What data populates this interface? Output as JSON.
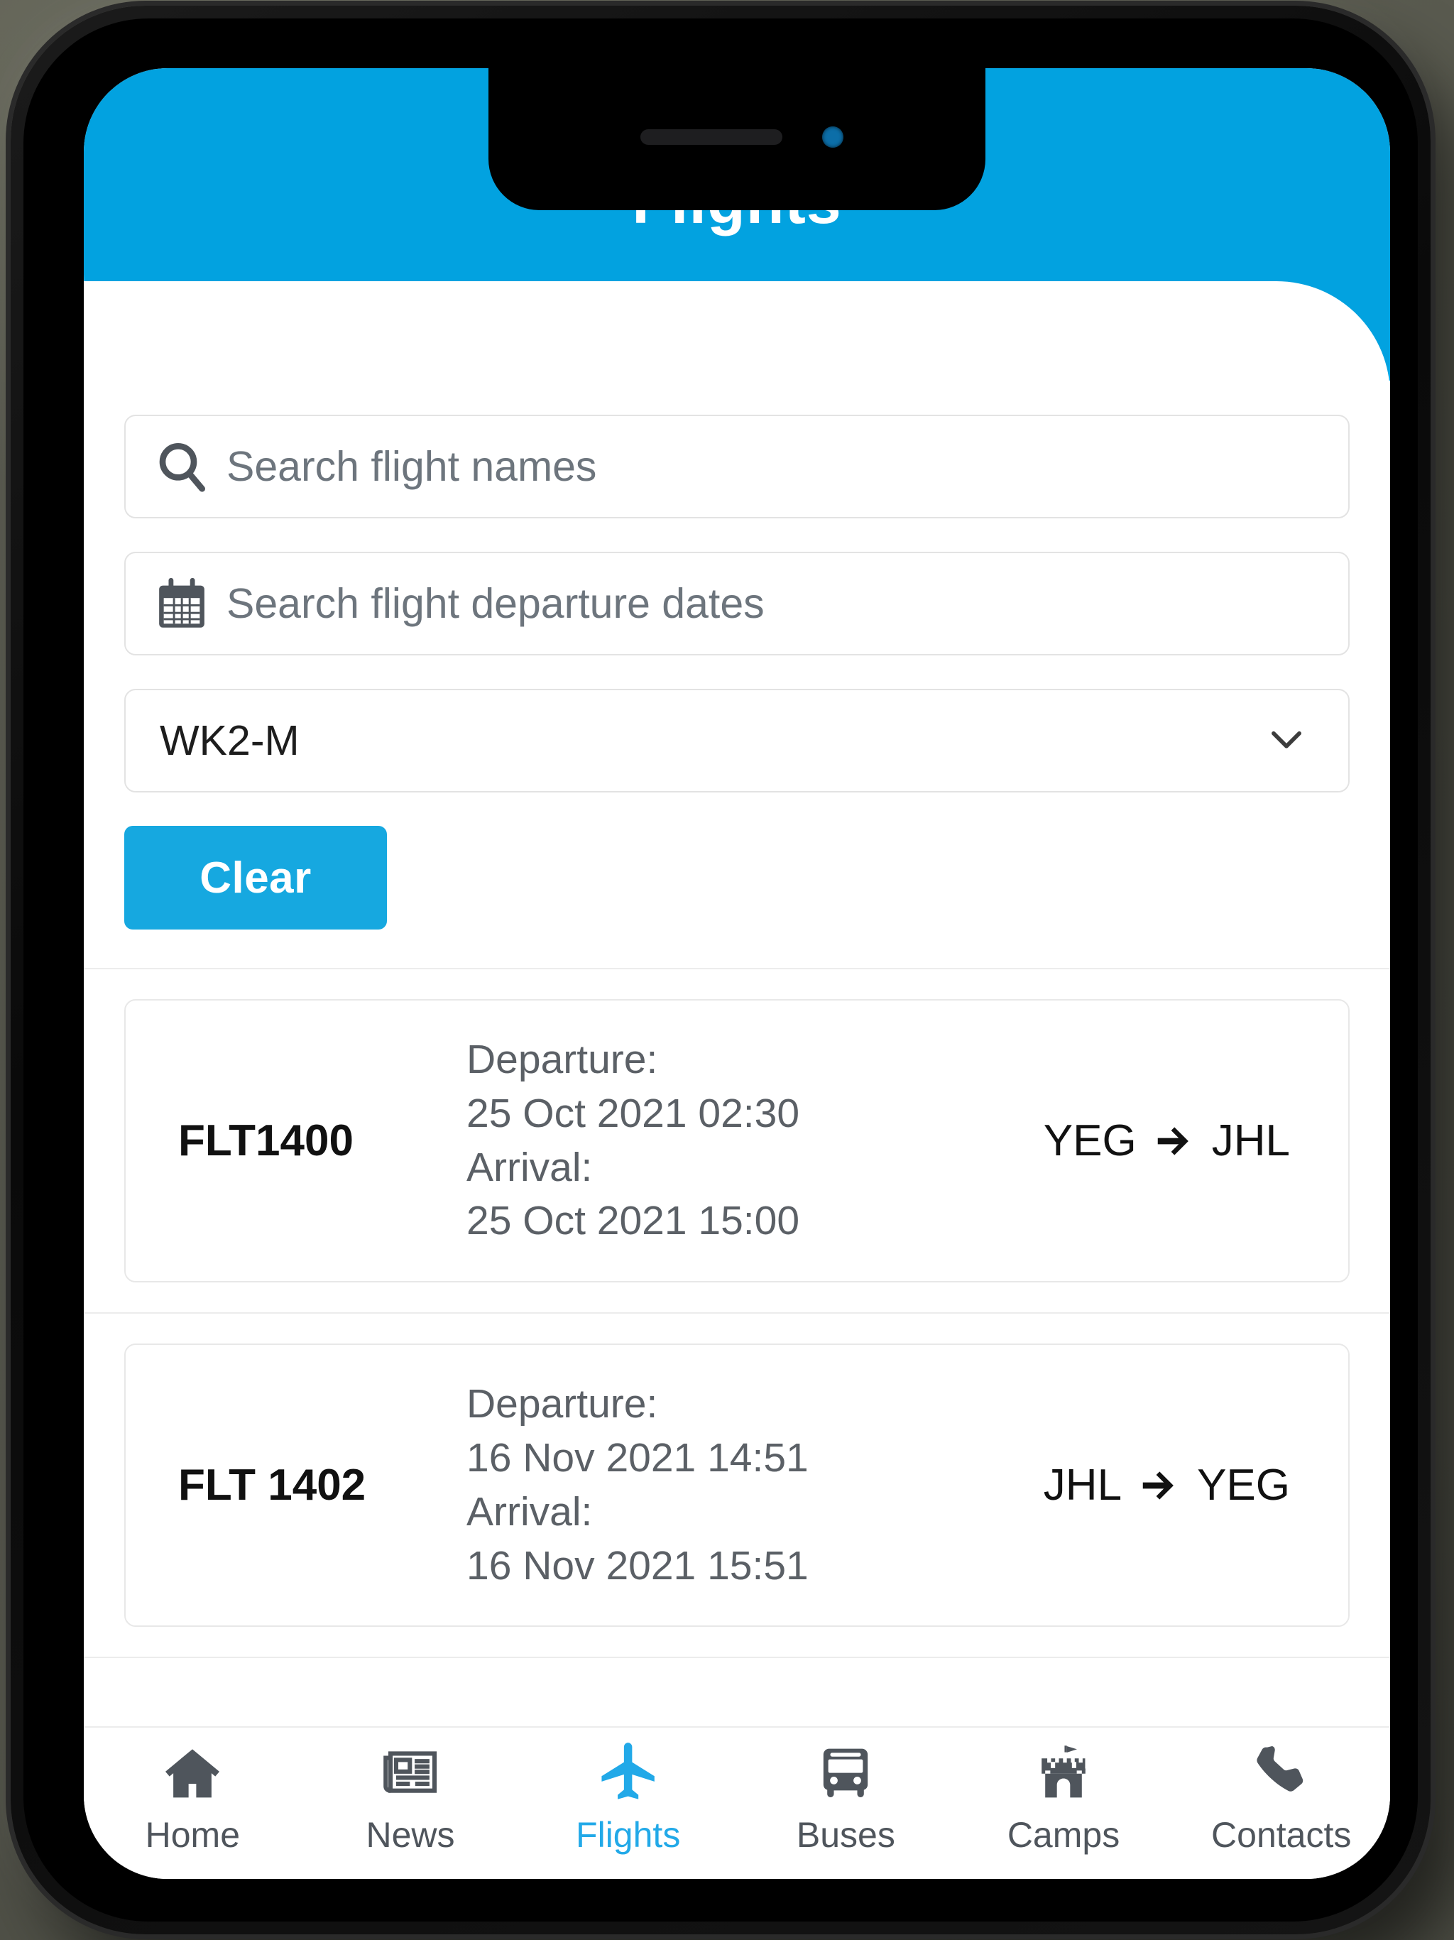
{
  "colors": {
    "accent": "#02a2e0",
    "accent_button": "#16a8e0",
    "tab_active": "#22a9e8",
    "text_dark": "#111111",
    "text_muted": "#5b6066",
    "placeholder": "#6d757d",
    "border": "#e3e3e3",
    "backdrop": "#55564c"
  },
  "header": {
    "title": "Flights"
  },
  "filters": {
    "search_name": {
      "icon": "search-icon",
      "placeholder": "Search flight names",
      "value": ""
    },
    "search_date": {
      "icon": "calendar-icon",
      "placeholder": "Search flight departure dates",
      "value": ""
    },
    "camp_select": {
      "icon": "chevron-down-icon",
      "selected": "WK2-M",
      "options": [
        "WK2-M"
      ]
    },
    "clear_button": {
      "label": "Clear"
    }
  },
  "flights": {
    "departure_label": "Departure:",
    "arrival_label": "Arrival:",
    "arrow": "➔",
    "items": [
      {
        "code": "FLT1400",
        "departure": "25 Oct 2021 02:30",
        "arrival": "25 Oct 2021 15:00",
        "origin": "YEG",
        "destination": "JHL"
      },
      {
        "code": "FLT 1402",
        "departure": "16 Nov 2021 14:51",
        "arrival": "16 Nov 2021 15:51",
        "origin": "JHL",
        "destination": "YEG"
      }
    ]
  },
  "tabbar": {
    "active_index": 2,
    "items": [
      {
        "label": "Home",
        "icon": "home-icon"
      },
      {
        "label": "News",
        "icon": "newspaper-icon"
      },
      {
        "label": "Flights",
        "icon": "airplane-icon"
      },
      {
        "label": "Buses",
        "icon": "bus-icon"
      },
      {
        "label": "Camps",
        "icon": "castle-icon"
      },
      {
        "label": "Contacts",
        "icon": "phone-icon"
      }
    ]
  }
}
